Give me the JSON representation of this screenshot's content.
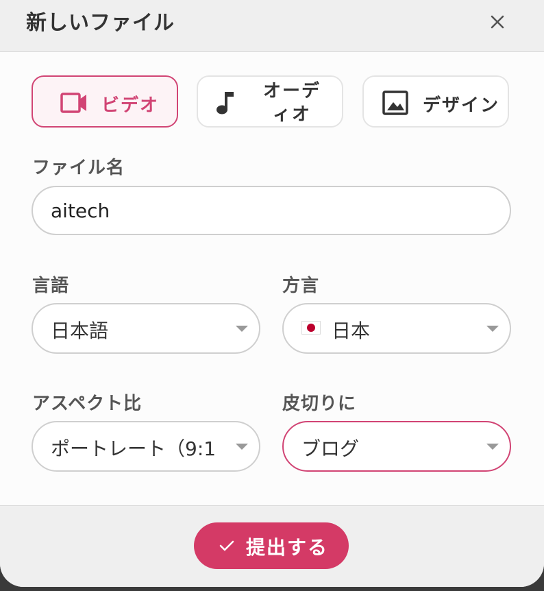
{
  "dialog": {
    "title": "新しいファイル",
    "close_icon": "close-icon"
  },
  "types": [
    {
      "label": "ビデオ",
      "icon": "video-camera-icon",
      "active": true
    },
    {
      "label": "オーディオ",
      "icon": "music-note-icon",
      "active": false
    },
    {
      "label": "デザイン",
      "icon": "image-icon",
      "active": false
    }
  ],
  "file_name": {
    "label": "ファイル名",
    "value": "aitech"
  },
  "language": {
    "label": "言語",
    "value": "日本語"
  },
  "dialect": {
    "label": "方言",
    "value": "日本",
    "flag_icon": "japan-flag-icon"
  },
  "aspect_ratio": {
    "label": "アスペクト比",
    "value": "ポートレート（9:1"
  },
  "crop_to": {
    "label": "皮切りに",
    "value": "ブログ"
  },
  "submit": {
    "label": "提出する",
    "icon": "check-icon"
  },
  "colors": {
    "accent": "#d43a66",
    "active_border": "#d14474",
    "active_bg": "#fdf3f6",
    "header_bg": "#efefef"
  }
}
